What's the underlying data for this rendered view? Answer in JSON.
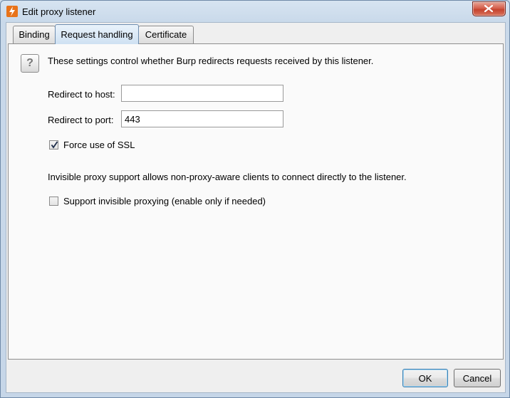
{
  "window": {
    "title": "Edit proxy listener",
    "app_icon": "burp-lightning-icon",
    "close_icon": "close-icon"
  },
  "tabs": [
    {
      "label": "Binding",
      "active": false
    },
    {
      "label": "Request handling",
      "active": true
    },
    {
      "label": "Certificate",
      "active": false
    }
  ],
  "request_handling": {
    "help_icon": "question-mark-icon",
    "intro_text": "These settings control whether Burp redirects requests received by this listener.",
    "redirect_host": {
      "label": "Redirect to host:",
      "value": ""
    },
    "redirect_port": {
      "label": "Redirect to port:",
      "value": "443"
    },
    "force_ssl": {
      "label": "Force use of SSL",
      "checked": true
    },
    "invisible_info": "Invisible proxy support allows non-proxy-aware clients to connect directly to the listener.",
    "invisible_proxy": {
      "label": "Support invisible proxying (enable only if needed)",
      "checked": false
    }
  },
  "buttons": {
    "ok": "OK",
    "cancel": "Cancel"
  },
  "colors": {
    "accent": "#3c7fb1",
    "close_button": "#c6432e",
    "app_icon": "#e8731a"
  }
}
